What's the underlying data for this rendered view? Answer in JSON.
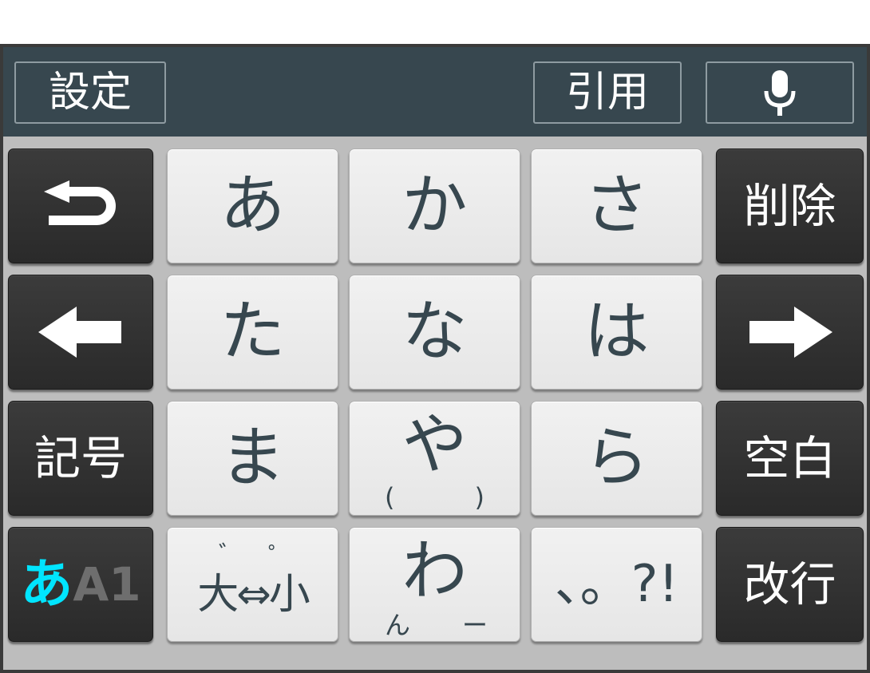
{
  "toolbar": {
    "settings_label": "設定",
    "quote_label": "引用",
    "mic_icon": "microphone-icon"
  },
  "rows": {
    "r1": {
      "undo_icon": "undo-arrow-icon",
      "k1": "あ",
      "k2": "か",
      "k3": "さ",
      "delete_label": "削除"
    },
    "r2": {
      "left_icon": "left-arrow-icon",
      "k1": "た",
      "k2": "な",
      "k3": "は",
      "right_icon": "right-arrow-icon"
    },
    "r3": {
      "symbols_label": "記号",
      "k1": "ま",
      "k2": "や",
      "k2_sub_left": "(",
      "k2_sub_right": ")",
      "k3": "ら",
      "space_label": "空白"
    },
    "r4": {
      "mode_kana": "あ",
      "mode_alnum": "A1",
      "case_dakuten": "゛",
      "case_handakuten": "゜",
      "case_label": "大⇔小",
      "k2": "わ",
      "k2_sub_left": "ん",
      "k2_sub_right": "ー",
      "punct_label": "、。?!",
      "enter_label": "改行"
    }
  },
  "colors": {
    "toolbar_bg": "#37474f",
    "dark_key": "#2f2f2f",
    "light_key": "#ececec",
    "kana_text": "#37474f",
    "mode_accent": "#00e5ff",
    "mode_inactive": "#6e6e6e"
  }
}
